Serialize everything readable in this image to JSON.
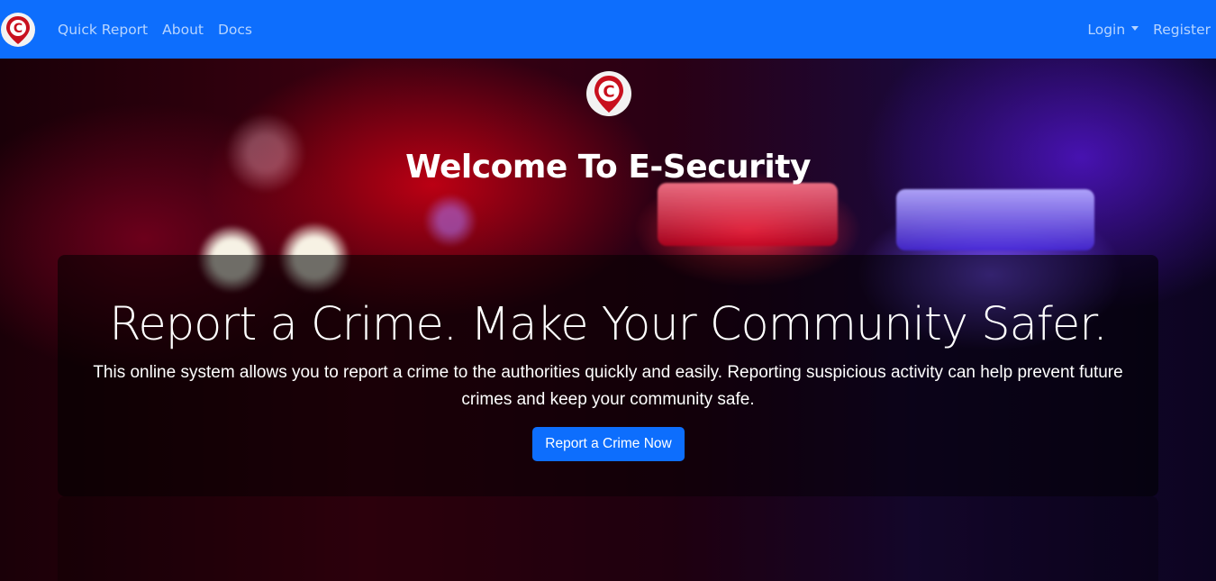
{
  "navbar": {
    "brand_icon": "map-pin-c-logo-icon",
    "links": [
      "Quick Report",
      "About",
      "Docs"
    ],
    "login_label": "Login",
    "register_label": "Register",
    "background_color": "#0d6efd"
  },
  "hero": {
    "logo_icon": "map-pin-c-logo-icon",
    "title": "Welcome To E-Security",
    "headline": "Report a Crime. Make Your Community Safer.",
    "lead": "This online system allows you to report a crime to the authorities quickly and easily. Reporting suspicious activity can help prevent future crimes and keep your community safe.",
    "cta_label": "Report a Crime Now",
    "cta_color": "#0d6efd"
  }
}
